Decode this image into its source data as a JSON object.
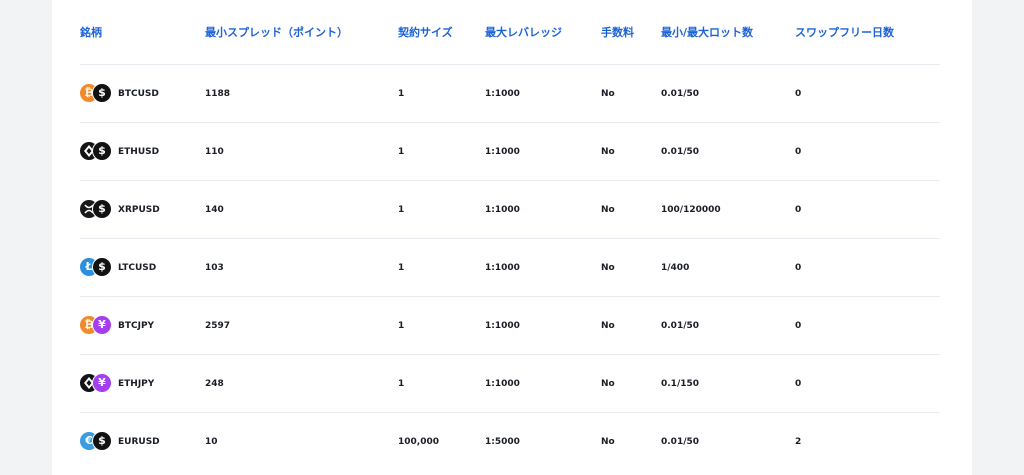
{
  "columns": [
    "銘柄",
    "最小スプレッド（ポイント）",
    "契約サイズ",
    "最大レバレッジ",
    "手数料",
    "最小/最大ロット数",
    "スワップフリー日数"
  ],
  "rows": [
    {
      "symbol": "BTCUSD",
      "base_icon": "bitcoin-icon",
      "quote_icon": "dollar-icon",
      "spread": "1188",
      "contract": "1",
      "leverage": "1:1000",
      "commission": "No",
      "lots": "0.01/50",
      "swap_free": "0"
    },
    {
      "symbol": "ETHUSD",
      "base_icon": "ethereum-icon",
      "quote_icon": "dollar-icon",
      "spread": "110",
      "contract": "1",
      "leverage": "1:1000",
      "commission": "No",
      "lots": "0.01/50",
      "swap_free": "0"
    },
    {
      "symbol": "XRPUSD",
      "base_icon": "ripple-icon",
      "quote_icon": "dollar-icon",
      "spread": "140",
      "contract": "1",
      "leverage": "1:1000",
      "commission": "No",
      "lots": "100/120000",
      "swap_free": "0"
    },
    {
      "symbol": "LTCUSD",
      "base_icon": "litecoin-icon",
      "quote_icon": "dollar-icon",
      "spread": "103",
      "contract": "1",
      "leverage": "1:1000",
      "commission": "No",
      "lots": "1/400",
      "swap_free": "0"
    },
    {
      "symbol": "BTCJPY",
      "base_icon": "bitcoin-icon",
      "quote_icon": "yen-icon",
      "spread": "2597",
      "contract": "1",
      "leverage": "1:1000",
      "commission": "No",
      "lots": "0.01/50",
      "swap_free": "0"
    },
    {
      "symbol": "ETHJPY",
      "base_icon": "ethereum-icon",
      "quote_icon": "yen-icon",
      "spread": "248",
      "contract": "1",
      "leverage": "1:1000",
      "commission": "No",
      "lots": "0.1/150",
      "swap_free": "0"
    },
    {
      "symbol": "EURUSD",
      "base_icon": "euro-icon",
      "quote_icon": "dollar-icon",
      "spread": "10",
      "contract": "100,000",
      "leverage": "1:5000",
      "commission": "No",
      "lots": "0.01/50",
      "swap_free": "2"
    }
  ],
  "colors": {
    "header_text": "#1d63d8",
    "body_text": "#1a1d26",
    "divider": "#e8ebf0",
    "page_bg": "#f2f3f5"
  }
}
